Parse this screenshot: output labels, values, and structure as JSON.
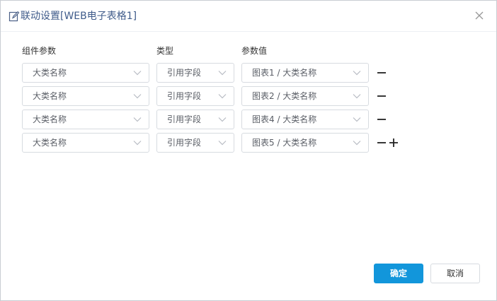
{
  "dialog": {
    "title": "联动设置[WEB电子表格1]",
    "icons": {
      "title": "edit-icon",
      "close": "close-icon"
    }
  },
  "headers": {
    "param": "组件参数",
    "type": "类型",
    "value": "参数值"
  },
  "rows": [
    {
      "param": "大类名称",
      "type": "引用字段",
      "value": "图表1 / 大类名称"
    },
    {
      "param": "大类名称",
      "type": "引用字段",
      "value": "图表2 / 大类名称"
    },
    {
      "param": "大类名称",
      "type": "引用字段",
      "value": "图表4 / 大类名称"
    },
    {
      "param": "大类名称",
      "type": "引用字段",
      "value": "图表5 / 大类名称"
    }
  ],
  "buttons": {
    "ok": "确定",
    "cancel": "取消"
  },
  "colors": {
    "primary": "#1296db",
    "title": "#3f5b8a"
  }
}
